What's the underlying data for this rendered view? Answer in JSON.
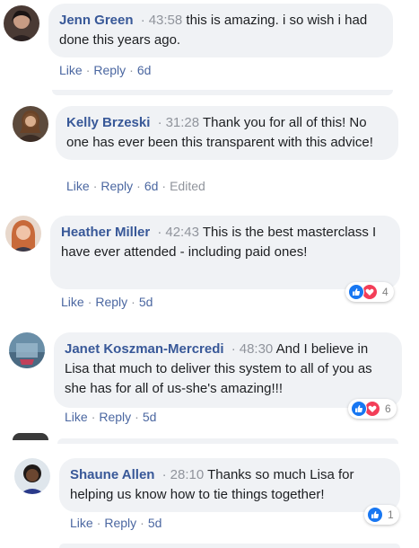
{
  "comments": [
    {
      "author": "Jenn Green",
      "timestamp": "43:58",
      "text": "this is amazing. i so wish i had done this years ago.",
      "like_label": "Like",
      "reply_label": "Reply",
      "age": "6d",
      "edited": "",
      "reaction_count": ""
    },
    {
      "author": "Kelly Brzeski",
      "timestamp": "31:28",
      "text": "Thank you for all of this! No one has ever been this transparent with this advice!",
      "like_label": "Like",
      "reply_label": "Reply",
      "age": "6d",
      "edited": "Edited",
      "reaction_count": ""
    },
    {
      "author": "Heather Miller",
      "timestamp": "42:43",
      "text": "This is the best masterclass I have ever attended - including paid ones!",
      "like_label": "Like",
      "reply_label": "Reply",
      "age": "5d",
      "edited": "",
      "reaction_count": "4"
    },
    {
      "author": "Janet Koszman-Mercredi",
      "timestamp": "48:30",
      "text": "And I believe in Lisa that much to deliver this system to all of you as she has for all of us-she's amazing!!!",
      "like_label": "Like",
      "reply_label": "Reply",
      "age": "5d",
      "edited": "",
      "reaction_count": "6"
    },
    {
      "author": "Shaune Allen",
      "timestamp": "28:10",
      "text": "Thanks so much Lisa for helping us know how to tie things together!",
      "like_label": "Like",
      "reply_label": "Reply",
      "age": "5d",
      "edited": "",
      "reaction_count": "1"
    }
  ],
  "separator": "·",
  "colors": {
    "bubble": "#f0f2f5",
    "author": "#385898",
    "link": "#4b67a1",
    "meta": "#90949c",
    "like_reaction": "#1877f2",
    "love_reaction": "#f33e58"
  },
  "reaction_icons": [
    "thumbs-up-icon",
    "heart-icon"
  ]
}
